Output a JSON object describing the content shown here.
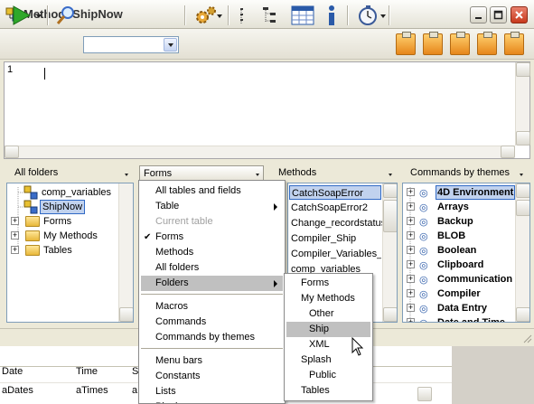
{
  "window": {
    "title": "Method: ShipNow",
    "controls": [
      "minimize",
      "maximize",
      "close"
    ]
  },
  "toolbar": {
    "run_icon": "play-icon",
    "search_icon": "magnifier-icon",
    "combo_value": ""
  },
  "editor": {
    "line_numbers": [
      "1"
    ],
    "content": ""
  },
  "panels": {
    "all_folders": {
      "header": "All folders",
      "items": [
        {
          "label": "comp_variables",
          "indent": 1
        },
        {
          "label": "ShipNow",
          "indent": 1,
          "selected": true
        },
        {
          "label": "Forms",
          "indent": 0,
          "expander": true
        },
        {
          "label": "My Methods",
          "indent": 0,
          "expander": true
        },
        {
          "label": "Tables",
          "indent": 0,
          "expander": true
        }
      ]
    },
    "forms": {
      "header": "Forms"
    },
    "methods": {
      "header": "Methods",
      "items": [
        {
          "label": "CatchSoapError",
          "selected": true
        },
        {
          "label": "CatchSoapError2"
        },
        {
          "label": "Change_recordstatus"
        },
        {
          "label": "Compiler_Ship"
        },
        {
          "label": "Compiler_Variables_I"
        },
        {
          "label": "comp_variables"
        }
      ]
    },
    "commands": {
      "header": "Commands by themes",
      "items": [
        {
          "label": "4D Environment",
          "selected": true
        },
        {
          "label": "Arrays"
        },
        {
          "label": "Backup"
        },
        {
          "label": "BLOB"
        },
        {
          "label": "Boolean"
        },
        {
          "label": "Clipboard"
        },
        {
          "label": "Communication"
        },
        {
          "label": "Compiler"
        },
        {
          "label": "Data Entry"
        },
        {
          "label": "Date and Time"
        }
      ]
    }
  },
  "dropdown_menu": {
    "items": [
      {
        "label": "All tables and fields"
      },
      {
        "label": "Table",
        "submenu": true
      },
      {
        "label": "Current table",
        "disabled": true
      },
      {
        "label": "Forms",
        "checked": true
      },
      {
        "label": "Methods"
      },
      {
        "label": "All folders"
      },
      {
        "label": "Folders",
        "submenu": true,
        "highlighted": true
      },
      {
        "separator": true
      },
      {
        "label": "Macros"
      },
      {
        "label": "Commands"
      },
      {
        "label": "Commands by themes"
      },
      {
        "separator": true
      },
      {
        "label": "Menu bars"
      },
      {
        "label": "Constants"
      },
      {
        "label": "Lists"
      },
      {
        "label": "Plugins"
      }
    ],
    "check_mark": "✔"
  },
  "folders_submenu": {
    "items": [
      {
        "label": "Forms",
        "indent": 0
      },
      {
        "label": "My Methods",
        "indent": 0
      },
      {
        "label": "Other",
        "indent": 1
      },
      {
        "label": "Ship",
        "indent": 1,
        "highlighted": true
      },
      {
        "label": "XML",
        "indent": 1
      },
      {
        "label": "Splash",
        "indent": 0
      },
      {
        "label": "Public",
        "indent": 1
      },
      {
        "label": "Tables",
        "indent": 0
      }
    ]
  },
  "bottom_table": {
    "headers": [
      "Date",
      "Time",
      "S"
    ],
    "row": [
      "aDates",
      "aTimes",
      "a"
    ]
  },
  "colors": {
    "selection": "#c1d2ee",
    "menu_highlight": "#c0c0c0",
    "titlebar": "#e4e2d6",
    "clipboard_orange": "#f0a030"
  }
}
